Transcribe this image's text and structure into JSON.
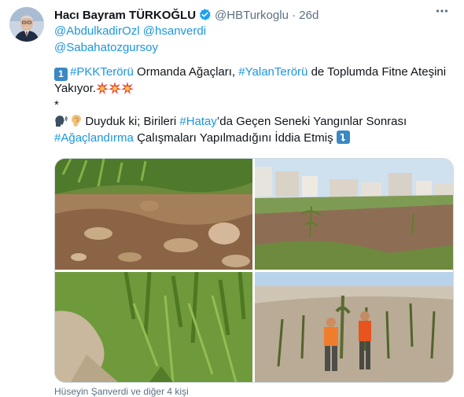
{
  "author": {
    "name": "Hacı Bayram TÜRKOĞLU",
    "handle": "@HBTurkoglu",
    "separator": "·",
    "time": "26d",
    "verified": true,
    "avatar_icon": "user-avatar-photo"
  },
  "more_icon": "more-horizontal-icon",
  "text": {
    "mention_1": "@AbdulkadirOzl",
    "mention_2": "@hsanverdi",
    "mention_3": "@Sabahatozgursoy",
    "keycap_1": "1",
    "hashtag_1": "#PKKTerörü",
    "seg_1": " Ormanda Ağaçları, ",
    "hashtag_2": "#YalanTerörü",
    "seg_2": " de Toplumda Fitne Ateşini",
    "seg_3": "Yakıyor.",
    "collision_icons": [
      "collision-emoji",
      "collision-emoji",
      "collision-emoji"
    ],
    "asterisk": "*",
    "speaking_head_icon": "speaking-head-emoji",
    "ear_icon": "ear-emoji",
    "seg_4": " Duyduk ki; Birileri ",
    "hashtag_3": "#Hatay",
    "seg_5": "’da Geçen Seneki Yangınlar Sonrası",
    "hashtag_4": "#Ağaçlandırma",
    "seg_6": " Çalışmaları Yapılmadığını İddia Etmiş ",
    "arrow_icon": "arrow-down-right-emoji"
  },
  "media": {
    "photos": [
      {
        "name": "photo-pine-seedlings-rocky-soil"
      },
      {
        "name": "photo-hillside-saplings-apartments"
      },
      {
        "name": "photo-dense-pine-seedlings"
      },
      {
        "name": "photo-workers-planting-saplings"
      }
    ]
  },
  "footer": {
    "liked_by": "Hüseyin Şanverdi ve diğer 4 kişi"
  },
  "colors": {
    "link": "#1b95e0",
    "muted": "#5b7083",
    "verified": "#1da1f2"
  }
}
